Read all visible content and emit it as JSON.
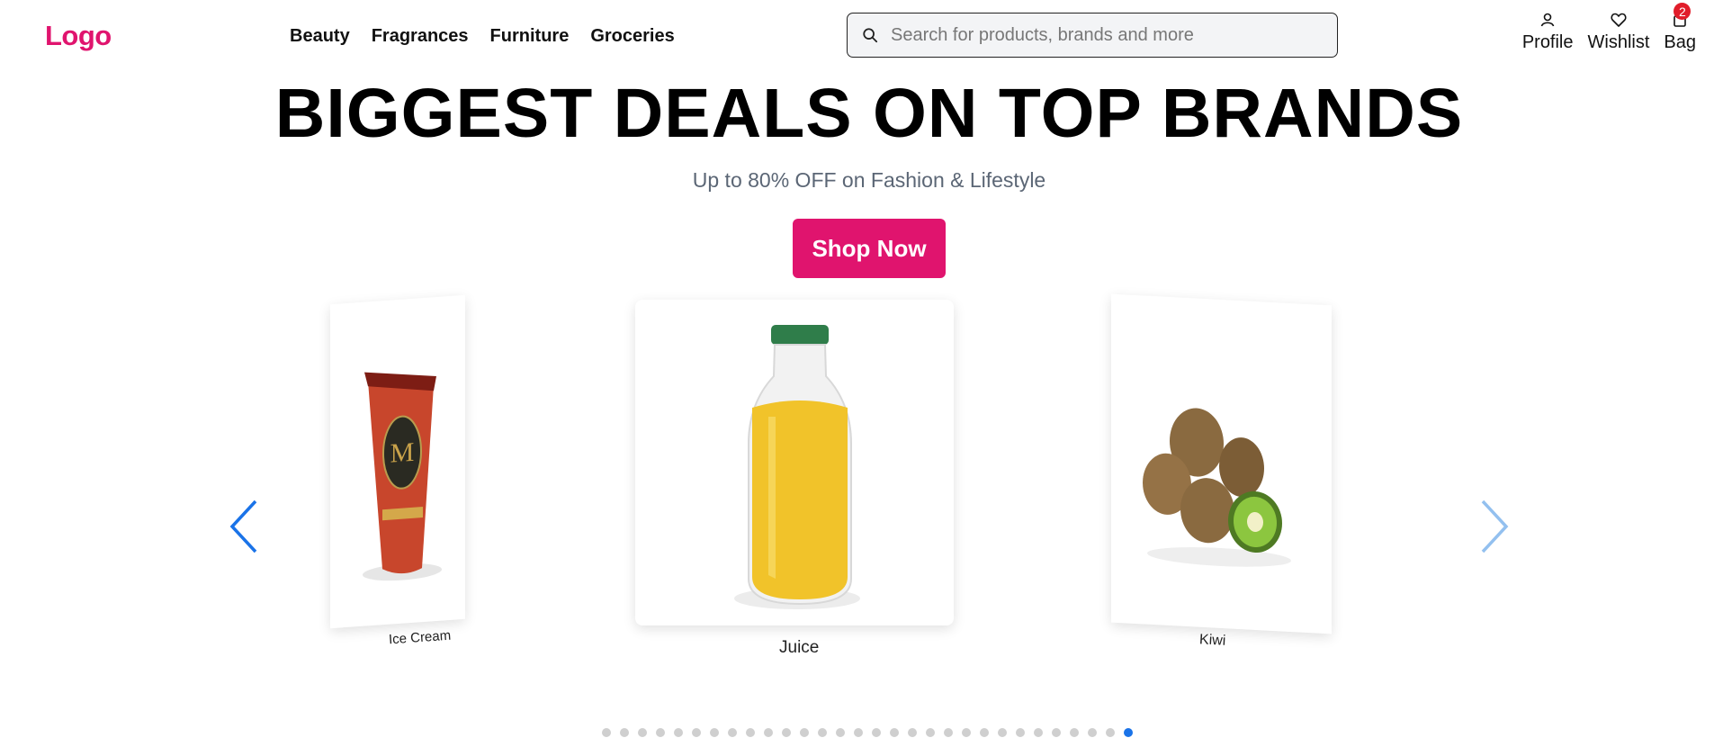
{
  "header": {
    "logo": "Logo",
    "nav": [
      "Beauty",
      "Fragrances",
      "Furniture",
      "Groceries"
    ],
    "search_placeholder": "Search for products, brands and more",
    "actions": {
      "profile": "Profile",
      "wishlist": "Wishlist",
      "bag": "Bag",
      "bag_count": "2"
    }
  },
  "hero": {
    "title": "BIGGEST DEALS ON TOP BRANDS",
    "subtitle": "Up to 80% OFF on Fashion & Lifestyle",
    "cta": "Shop Now"
  },
  "carousel": {
    "items": [
      {
        "label": "Ice Cream",
        "icon": "ice-cream-tub-icon"
      },
      {
        "label": "Juice",
        "icon": "juice-bottle-icon"
      },
      {
        "label": "Kiwi",
        "icon": "kiwi-fruit-icon"
      }
    ],
    "dot_count": 30,
    "active_dot": 29
  },
  "colors": {
    "brand": "#e0146e",
    "accent": "#1a73e8",
    "badge": "#e11d2a"
  }
}
